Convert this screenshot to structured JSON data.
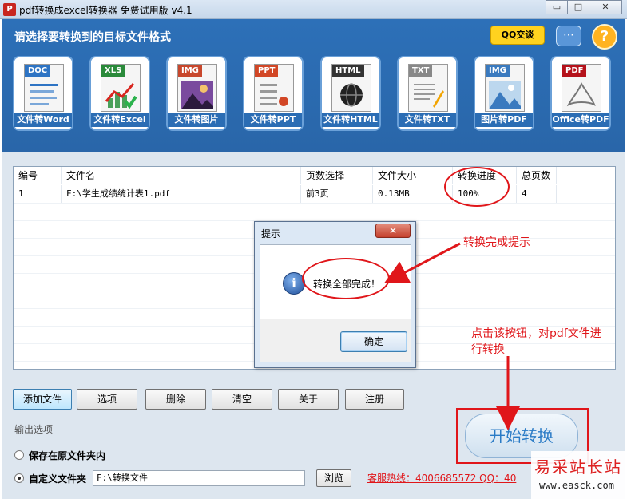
{
  "window": {
    "title": "pdf转换成excel转换器 免费试用版 v4.1",
    "min": "▭",
    "max": "□",
    "close": "✕"
  },
  "banner": {
    "title": "请选择要转换到的目标文件格式",
    "qq_label": "QQ交谈",
    "chat_icon": "⋯",
    "help_icon": "?"
  },
  "tools": [
    {
      "badge": "DOC",
      "label": "文件转Word",
      "color": "#2e74c4"
    },
    {
      "badge": "XLS",
      "label": "文件转Excel",
      "color": "#2a8a3a"
    },
    {
      "badge": "IMG",
      "label": "文件转图片",
      "color": "#c8472c"
    },
    {
      "badge": "PPT",
      "label": "文件转PPT",
      "color": "#d24726"
    },
    {
      "badge": "HTML",
      "label": "文件转HTML",
      "color": "#333333"
    },
    {
      "badge": "TXT",
      "label": "文件转TXT",
      "color": "#888888"
    },
    {
      "badge": "IMG",
      "label": "图片转PDF",
      "color": "#3a7abf"
    },
    {
      "badge": "PDF",
      "label": "Office转PDF",
      "color": "#b5121b"
    }
  ],
  "table": {
    "headers": [
      "编号",
      "文件名",
      "页数选择",
      "文件大小",
      "转换进度",
      "总页数"
    ],
    "rows": [
      {
        "id": "1",
        "file": "F:\\学生成绩统计表1.pdf",
        "pages": "前3页",
        "size": "0.13MB",
        "progress": "100%",
        "total": "4"
      }
    ]
  },
  "dialog": {
    "title": "提示",
    "close": "✕",
    "info_icon": "i",
    "message": "转换全部完成！",
    "ok": "确定"
  },
  "annotations": {
    "done_tip": "转换完成提示",
    "click_tip_line1": "点击该按钮，对pdf文件进",
    "click_tip_line2": "行转换"
  },
  "buttons": {
    "add": "添加文件",
    "options": "选项",
    "delete": "删除",
    "clear": "清空",
    "about": "关于",
    "register": "注册"
  },
  "output": {
    "label": "输出选项",
    "option1": "保存在原文件夹内",
    "option2": "自定义文件夹",
    "path": "F:\\转换文件",
    "browse": "浏览",
    "hotline": "客服热线：4006685572 QQ：40"
  },
  "start_button": "开始转换",
  "watermark": {
    "cn": "易采站长站",
    "en": "www.easck.com"
  }
}
